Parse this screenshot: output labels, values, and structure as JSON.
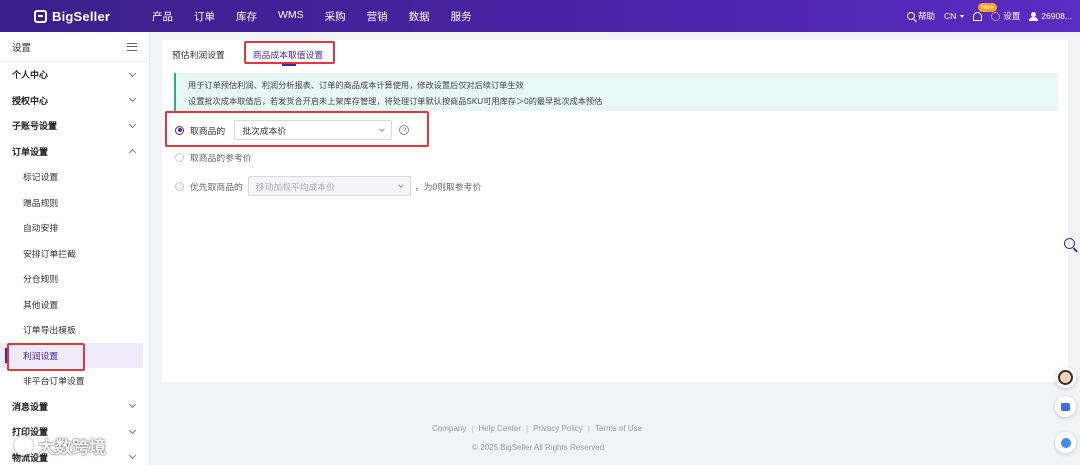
{
  "brand": {
    "name": "BigSeller"
  },
  "nav": [
    "产品",
    "订单",
    "库存",
    "WMS",
    "采购",
    "营销",
    "数据",
    "服务"
  ],
  "topbar": {
    "help": "帮助",
    "language": "CN",
    "new_badge": "New",
    "settings": "设置",
    "user": "26908..."
  },
  "sidebar": {
    "title": "设置",
    "groups": [
      {
        "label": "个人中心"
      },
      {
        "label": "授权中心"
      },
      {
        "label": "子账号设置"
      },
      {
        "label": "订单设置",
        "expanded": true
      }
    ],
    "order_items": [
      "标记设置",
      "赠品规则",
      "自动安排",
      "安排订单拦截",
      "分仓规则",
      "其他设置",
      "订单导出模板",
      "利润设置",
      "非平台订单设置"
    ],
    "after_groups": [
      "消息设置",
      "打印设置",
      "物流设置"
    ]
  },
  "tabs": [
    "预估利润设置",
    "商品成本取值设置"
  ],
  "notice": {
    "line1": "用于订单预估利润、利润分析报表、订单的商品成本计算使用，修改设置后仅对后续订单生效",
    "line2": "设置批次成本取值后，若发货合开启未上架库存管理，待处理订单默认按商品SKU可用库存＞0的最早批次成本预估"
  },
  "options": {
    "opt1": {
      "label": "取商品的",
      "select_value": "批次成本价",
      "help": "?"
    },
    "opt2": {
      "label": "取商品的参考价"
    },
    "opt3": {
      "label": "优先取商品的",
      "select_value": "移动加权平均成本价",
      "suffix": "，为0则取参考价"
    }
  },
  "footer": {
    "links": [
      "Company",
      "Help Center",
      "Privacy Policy",
      "Terms of Use"
    ],
    "separator": "|",
    "copyright": "© 2025 BigSeller All Rights Reserved"
  },
  "watermark": {
    "text": "大数跨境"
  },
  "colors": {
    "brand": "#4a23a6",
    "highlight": "#e0383e",
    "notice_bg": "#e8f8f4"
  }
}
